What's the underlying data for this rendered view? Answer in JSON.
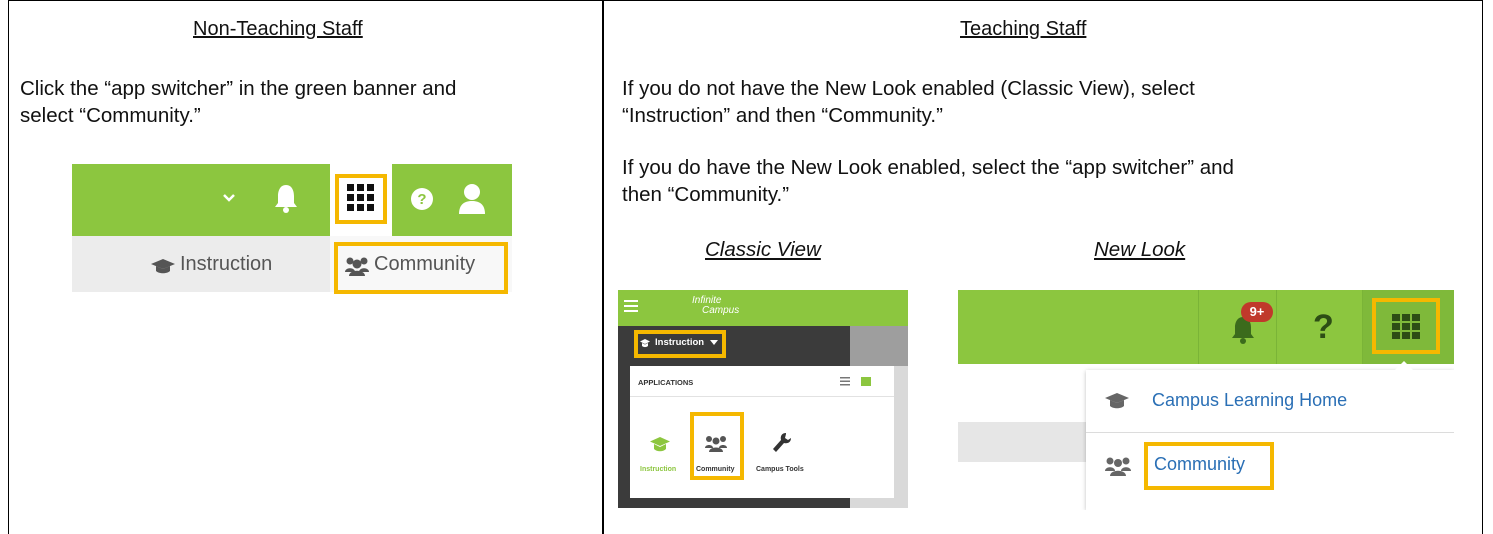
{
  "left": {
    "header": "Non-Teaching Staff",
    "instruction_line1": "Click the “app switcher” in the green banner and",
    "instruction_line2": "select “Community.”",
    "shot": {
      "instruction_label": "Instruction",
      "community_label": "Community"
    }
  },
  "right": {
    "header": "Teaching Staff",
    "para1_line1": "If you do not have the New Look enabled (Classic View), select",
    "para1_line2": "“Instruction” and then “Community.”",
    "para2_line1": "If you do have the New Look enabled, select the “app switcher” and",
    "para2_line2": "then “Community.”",
    "classic_caption": "Classic View",
    "newlook_caption": "New Look",
    "classic": {
      "logo_line1": "Infinite",
      "logo_line2": "Campus",
      "menu_label": "Instruction",
      "applications_label": "APPLICATIONS",
      "apps": [
        "Instruction",
        "Community",
        "Campus Tools"
      ]
    },
    "newlook": {
      "badge": "9+",
      "help": "?",
      "menu_items": [
        "Campus Learning Home",
        "Community"
      ]
    }
  },
  "colors": {
    "green": "#8cc63f",
    "highlight": "#f5b800",
    "link_blue": "#2a6fb5"
  }
}
